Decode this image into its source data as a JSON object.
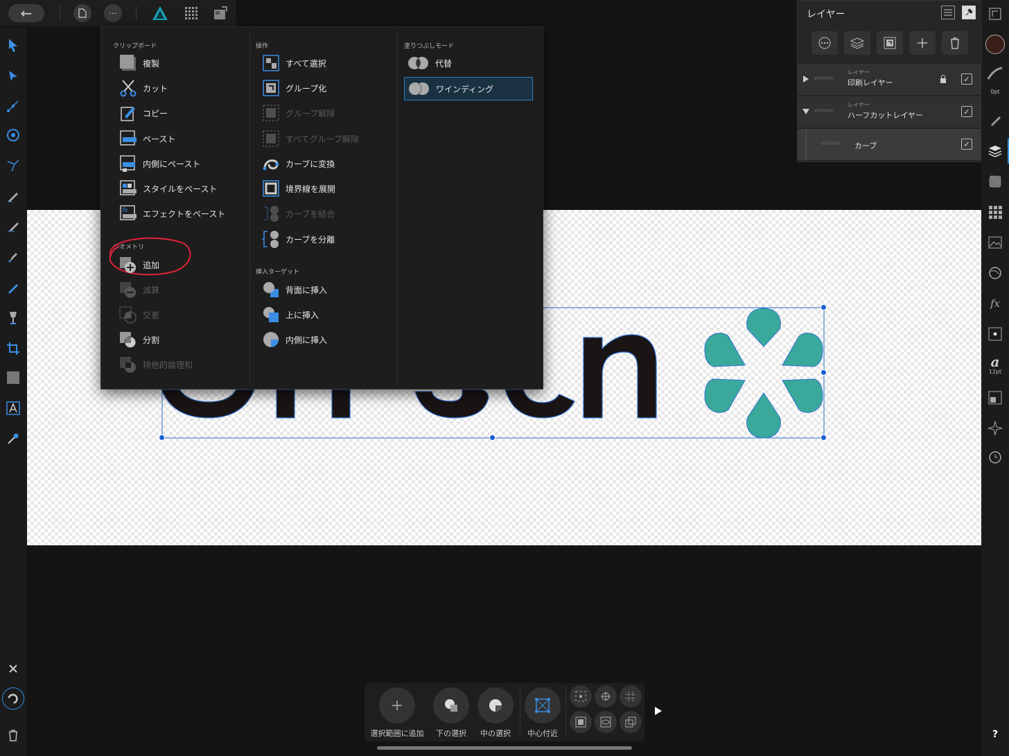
{
  "topbar": {
    "back_icon": "←",
    "doc_icon": "document-icon",
    "more_icon": "⋯"
  },
  "menu": {
    "clipboard": {
      "title": "クリップボード",
      "items": [
        "複製",
        "カット",
        "コピー",
        "ペースト",
        "内側にペースト",
        "スタイルをペースト",
        "エフェクトをペースト"
      ]
    },
    "geometry": {
      "title": "ジオメトリ",
      "items": [
        "追加",
        "減算",
        "交差",
        "分割",
        "排他的論理和"
      ],
      "disabled": [
        false,
        true,
        true,
        false,
        true
      ]
    },
    "operations": {
      "title": "操作",
      "items": [
        "すべて選択",
        "グループ化",
        "グループ解除",
        "すべてグループ解除",
        "カーブに変換",
        "境界線を展開",
        "カーブを結合",
        "カーブを分離"
      ],
      "disabled": [
        false,
        false,
        true,
        true,
        false,
        false,
        true,
        false
      ]
    },
    "insert_target": {
      "title": "挿入ターゲット",
      "items": [
        "背面に挿入",
        "上に挿入",
        "内側に挿入"
      ]
    },
    "fill_mode": {
      "title": "塗りつぶしモード",
      "items": [
        "代替",
        "ワインディング"
      ],
      "selected": "ワインディング"
    }
  },
  "layers": {
    "title": "レイヤー",
    "rows": [
      {
        "type": "レイヤー",
        "name": "印刷レイヤー",
        "thumb": "onsen",
        "locked": true,
        "visible": true,
        "expanded": false
      },
      {
        "type": "レイヤー",
        "name": "ハーフカットレイヤー",
        "thumb": "onsen",
        "locked": false,
        "visible": true,
        "expanded": true
      },
      {
        "type": "",
        "name": "カーブ",
        "thumb": "onsen",
        "locked": false,
        "visible": true,
        "expanded": false
      }
    ]
  },
  "right_tools": {
    "stroke_width": "0pt",
    "font_size": "12pt",
    "help": "?"
  },
  "canvas": {
    "logo_text": "onsen",
    "logo_color": "#1a1414",
    "flower_color": "#3aa99b"
  },
  "bottom_bar": {
    "buttons": [
      "選択範囲に追加",
      "下の選択",
      "中の選択",
      "中心付近"
    ]
  },
  "colors": {
    "accent": "#2c8ee8",
    "annotation": "#e0233a",
    "panel": "#1d1d1d"
  }
}
